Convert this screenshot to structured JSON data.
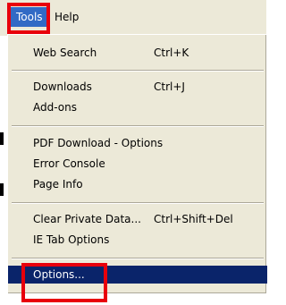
{
  "menubar": {
    "items": [
      {
        "label": "Tools",
        "active": true
      },
      {
        "label": "Help",
        "active": false
      }
    ]
  },
  "dropdown": {
    "sections": [
      {
        "items": [
          {
            "label": "Web Search",
            "shortcut": "Ctrl+K"
          }
        ]
      },
      {
        "items": [
          {
            "label": "Downloads",
            "shortcut": "Ctrl+J"
          },
          {
            "label": "Add-ons",
            "shortcut": ""
          }
        ]
      },
      {
        "items": [
          {
            "label": "PDF Download - Options",
            "shortcut": ""
          },
          {
            "label": "Error Console",
            "shortcut": ""
          },
          {
            "label": "Page Info",
            "shortcut": ""
          }
        ]
      },
      {
        "items": [
          {
            "label": "Clear Private Data...",
            "shortcut": "Ctrl+Shift+Del"
          },
          {
            "label": "IE Tab Options",
            "shortcut": ""
          }
        ]
      },
      {
        "items": [
          {
            "label": "Options...",
            "shortcut": "",
            "selected": true
          }
        ]
      }
    ]
  },
  "colors": {
    "menu_bg": "#ece9d8",
    "selection_bg": "#0a246a",
    "highlight_box": "#e8000b",
    "active_menubar_bg": "#316ac5"
  }
}
